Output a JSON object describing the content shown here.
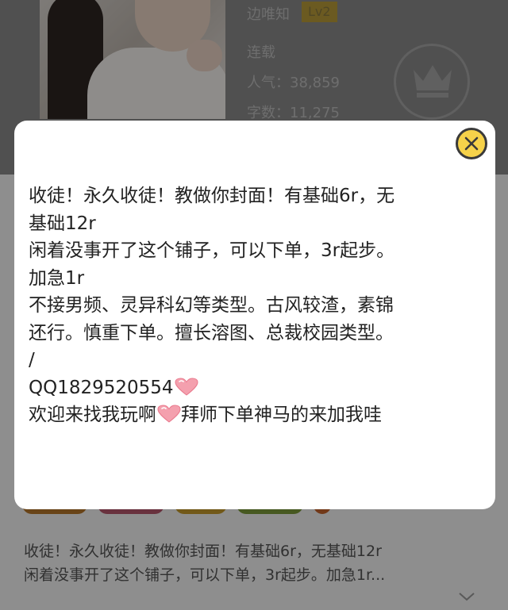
{
  "header": {
    "author_name": "边唯知",
    "level_badge": "Lv2",
    "status": "连载",
    "popularity": "人气：38,859",
    "word_count": "字数：11,275"
  },
  "description": {
    "line1": "收徒！永久收徒！教做你封面！有基础6r，无基础12r",
    "line2": "闲着没事开了这个铺子，可以下单，3r起步。加急1r..."
  },
  "modal": {
    "lines": [
      "收徒！永久收徒！教做你封面！有基础6r，无",
      "基础12r",
      "闲着没事开了这个铺子，可以下单，3r起步。",
      "加急1r",
      "不接男频、灵异科幻等类型。古风较渣，素锦",
      "还行。慎重下单。擅长溶图、总裁校园类型。",
      "/"
    ],
    "qq": "QQ1829520554",
    "welcome_part1": "欢迎来找我玩啊",
    "welcome_part2": "拜师下单神马的来加我哇"
  },
  "icons": {
    "close": "close-icon",
    "heart": "heart-icon",
    "crown": "crown-icon",
    "expand": "chevron-down-icon"
  },
  "colors": {
    "close_button": "#f6d24a",
    "level_badge": "#b99b3a",
    "heart": "#f08a9c"
  }
}
